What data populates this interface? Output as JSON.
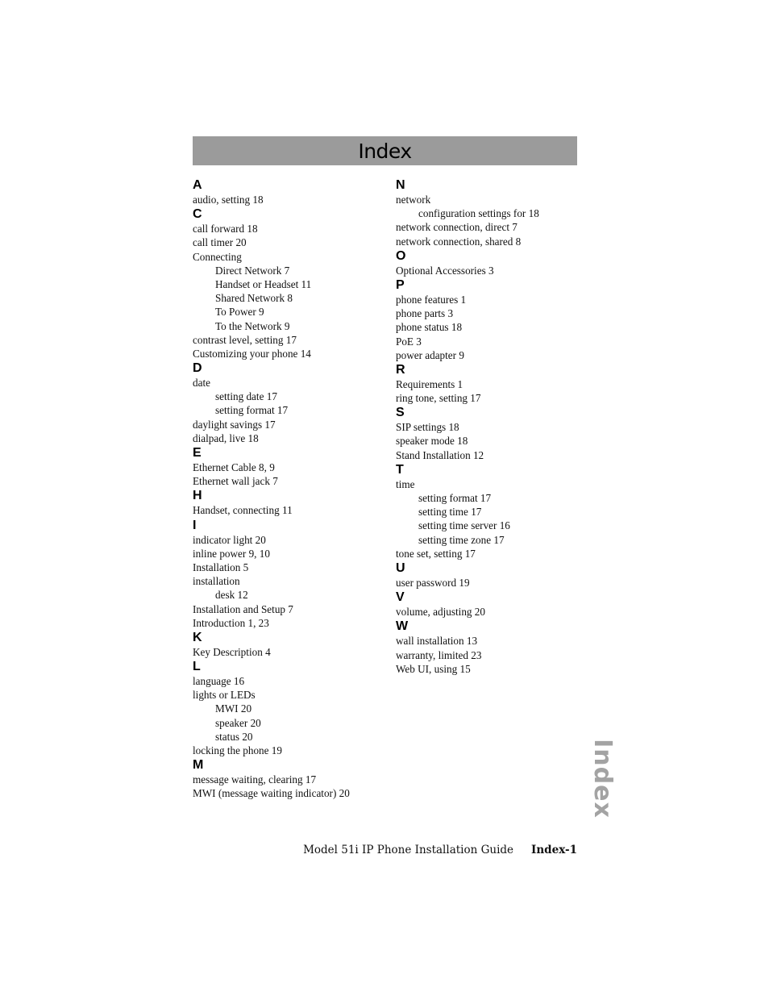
{
  "page": {
    "title": "Index",
    "side_tab": "Index",
    "footer": {
      "guide_title": "Model 51i IP Phone Installation Guide",
      "page_number": "Index-1"
    }
  },
  "columns": [
    {
      "sections": [
        {
          "letter": "A",
          "entries": [
            {
              "text": "audio, setting 18",
              "sub": false
            }
          ]
        },
        {
          "letter": "C",
          "entries": [
            {
              "text": "call forward 18",
              "sub": false
            },
            {
              "text": "call timer 20",
              "sub": false
            },
            {
              "text": "Connecting",
              "sub": false
            },
            {
              "text": "Direct Network 7",
              "sub": true
            },
            {
              "text": "Handset or Headset 11",
              "sub": true
            },
            {
              "text": "Shared Network 8",
              "sub": true
            },
            {
              "text": "To Power 9",
              "sub": true
            },
            {
              "text": "To the Network 9",
              "sub": true
            },
            {
              "text": "contrast level, setting 17",
              "sub": false
            },
            {
              "text": "Customizing your phone 14",
              "sub": false
            }
          ]
        },
        {
          "letter": "D",
          "entries": [
            {
              "text": "date",
              "sub": false
            },
            {
              "text": "setting date 17",
              "sub": true
            },
            {
              "text": "setting format 17",
              "sub": true
            },
            {
              "text": "daylight savings 17",
              "sub": false
            },
            {
              "text": "dialpad, live 18",
              "sub": false
            }
          ]
        },
        {
          "letter": "E",
          "entries": [
            {
              "text": "Ethernet Cable 8, 9",
              "sub": false
            },
            {
              "text": "Ethernet wall jack 7",
              "sub": false
            }
          ]
        },
        {
          "letter": "H",
          "entries": [
            {
              "text": "Handset, connecting 11",
              "sub": false
            }
          ]
        },
        {
          "letter": "I",
          "entries": [
            {
              "text": "indicator light 20",
              "sub": false
            },
            {
              "text": "inline power 9, 10",
              "sub": false
            },
            {
              "text": "Installation 5",
              "sub": false
            },
            {
              "text": "installation",
              "sub": false
            },
            {
              "text": "desk 12",
              "sub": true
            },
            {
              "text": "Installation and Setup 7",
              "sub": false
            },
            {
              "text": "Introduction 1, 23",
              "sub": false
            }
          ]
        },
        {
          "letter": "K",
          "entries": [
            {
              "text": "Key Description 4",
              "sub": false
            }
          ]
        },
        {
          "letter": "L",
          "entries": [
            {
              "text": "language 16",
              "sub": false
            },
            {
              "text": "lights or LEDs",
              "sub": false
            },
            {
              "text": "MWI 20",
              "sub": true
            },
            {
              "text": "speaker 20",
              "sub": true
            },
            {
              "text": "status 20",
              "sub": true
            },
            {
              "text": "locking the phone 19",
              "sub": false
            }
          ]
        },
        {
          "letter": "M",
          "entries": [
            {
              "text": "message waiting, clearing 17",
              "sub": false
            },
            {
              "text": "MWI (message waiting indicator) 20",
              "sub": false
            }
          ]
        }
      ]
    },
    {
      "sections": [
        {
          "letter": "N",
          "entries": [
            {
              "text": "network",
              "sub": false
            },
            {
              "text": "configuration settings for 18",
              "sub": true
            },
            {
              "text": "network connection, direct 7",
              "sub": false
            },
            {
              "text": "network connection, shared 8",
              "sub": false
            }
          ]
        },
        {
          "letter": "O",
          "entries": [
            {
              "text": "Optional Accessories 3",
              "sub": false
            }
          ]
        },
        {
          "letter": "P",
          "entries": [
            {
              "text": "phone features 1",
              "sub": false
            },
            {
              "text": "phone parts 3",
              "sub": false
            },
            {
              "text": "phone status 18",
              "sub": false
            },
            {
              "text": "PoE 3",
              "sub": false
            },
            {
              "text": "power adapter 9",
              "sub": false
            }
          ]
        },
        {
          "letter": "R",
          "entries": [
            {
              "text": "Requirements 1",
              "sub": false
            },
            {
              "text": "ring tone, setting 17",
              "sub": false
            }
          ]
        },
        {
          "letter": "S",
          "entries": [
            {
              "text": "SIP settings 18",
              "sub": false
            },
            {
              "text": "speaker mode 18",
              "sub": false
            },
            {
              "text": "Stand Installation 12",
              "sub": false
            }
          ]
        },
        {
          "letter": "T",
          "entries": [
            {
              "text": "time",
              "sub": false
            },
            {
              "text": "setting format 17",
              "sub": true
            },
            {
              "text": "setting time 17",
              "sub": true
            },
            {
              "text": "setting time server 16",
              "sub": true
            },
            {
              "text": "setting time zone 17",
              "sub": true
            },
            {
              "text": "tone set, setting 17",
              "sub": false
            }
          ]
        },
        {
          "letter": "U",
          "entries": [
            {
              "text": "user password 19",
              "sub": false
            }
          ]
        },
        {
          "letter": "V",
          "entries": [
            {
              "text": "volume, adjusting 20",
              "sub": false
            }
          ]
        },
        {
          "letter": "W",
          "entries": [
            {
              "text": "wall installation 13",
              "sub": false
            },
            {
              "text": "warranty, limited 23",
              "sub": false
            },
            {
              "text": "Web UI, using 15",
              "sub": false
            }
          ]
        }
      ]
    }
  ]
}
